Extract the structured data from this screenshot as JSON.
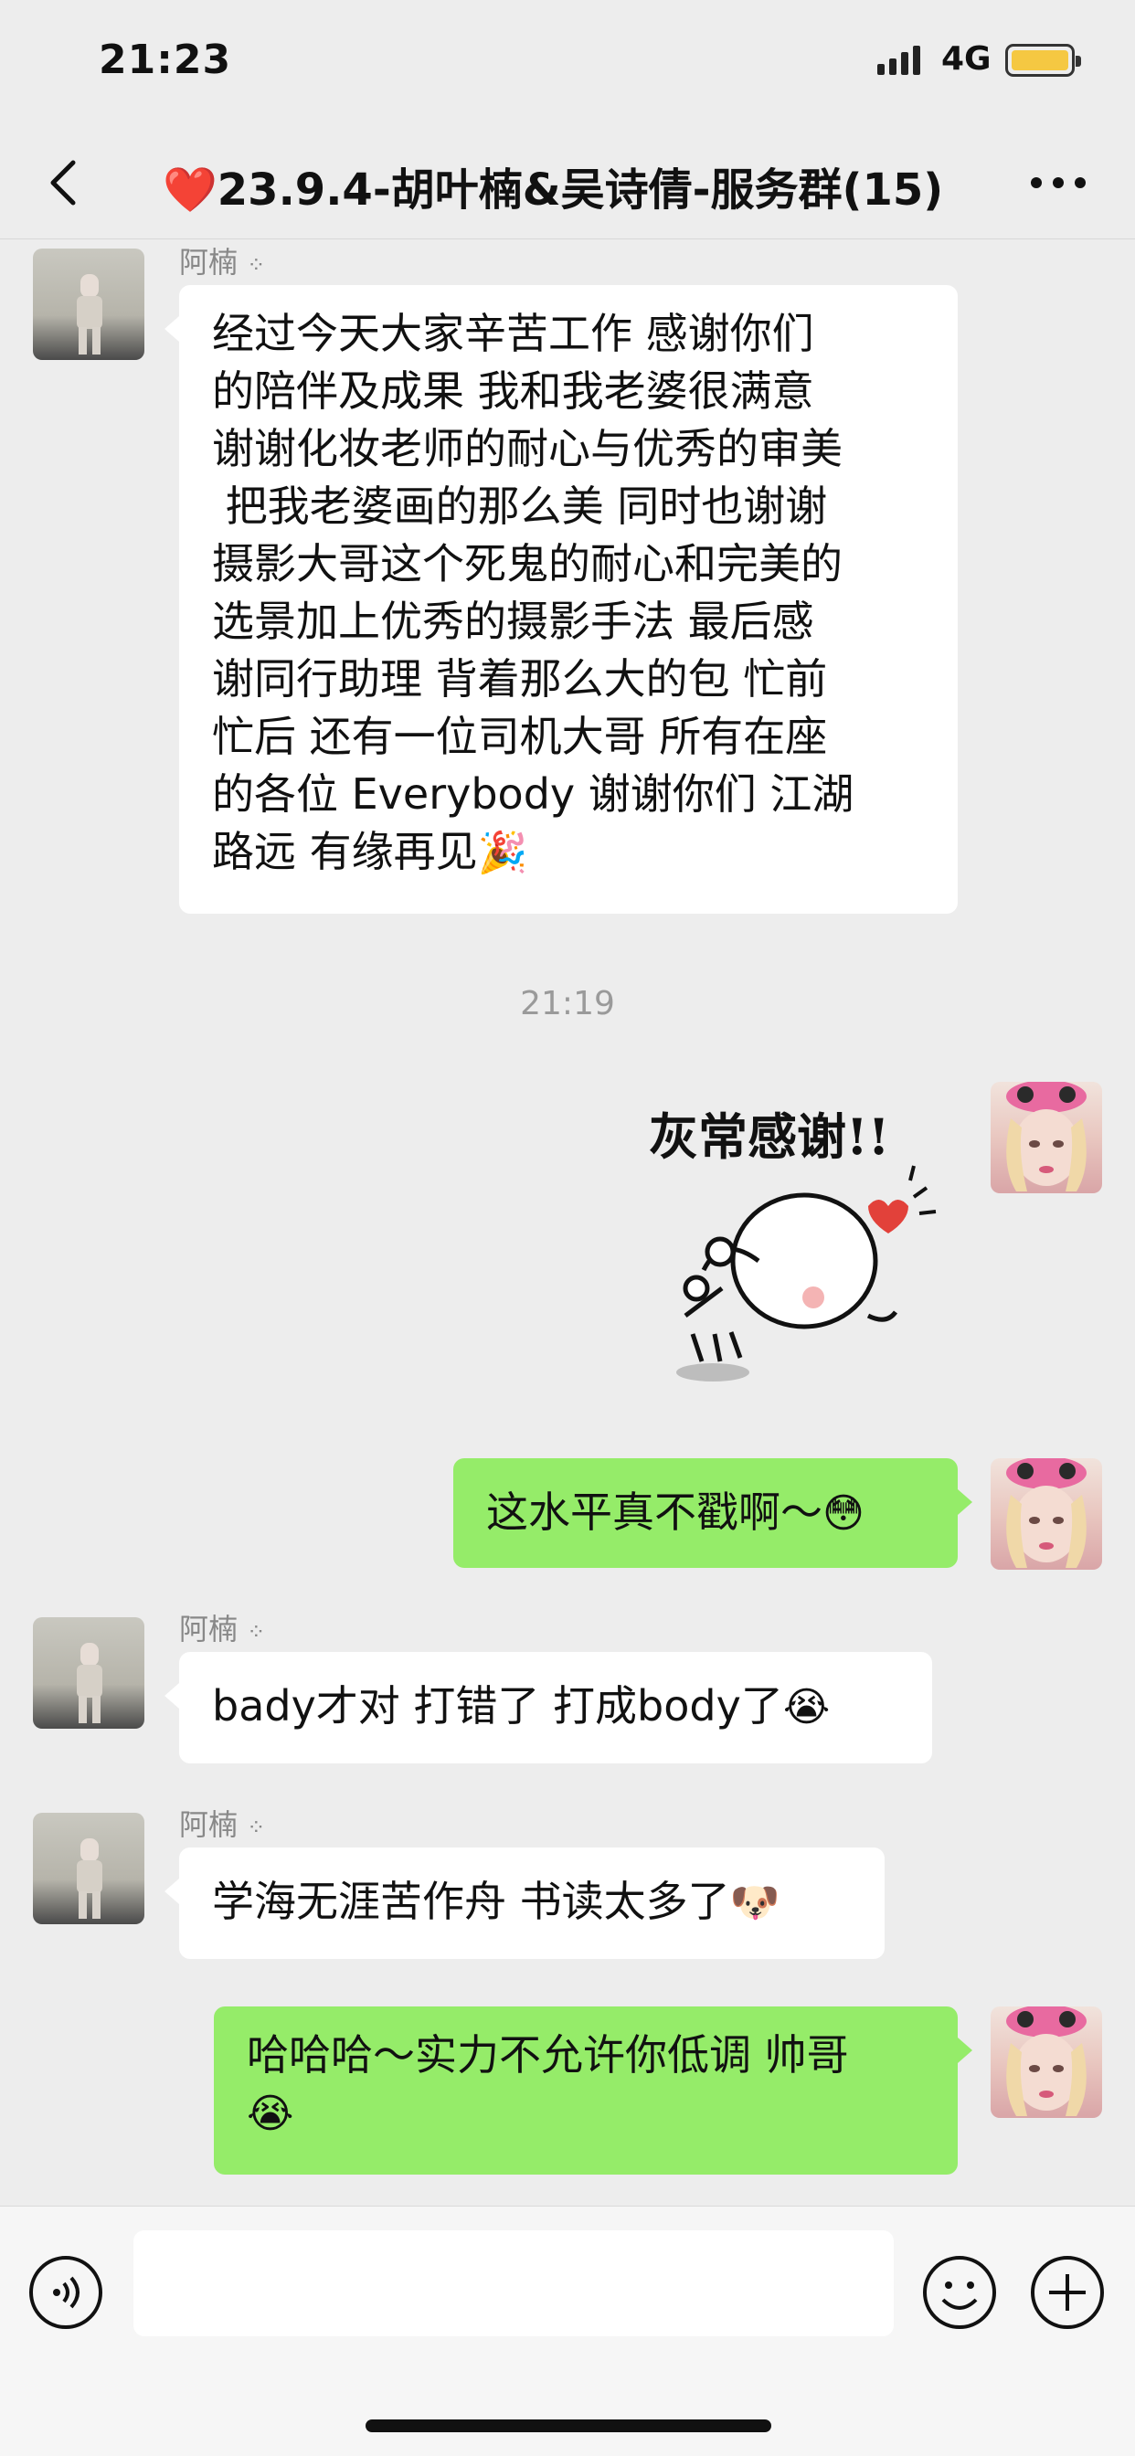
{
  "status_bar": {
    "time": "21:23",
    "network": "4G"
  },
  "nav": {
    "title": "❤️23.9.4-胡叶楠&吴诗倩-服务群(15)"
  },
  "messages": {
    "m1": {
      "sender": "阿楠",
      "lines": [
        "经过今天大家辛苦工作 感谢你们",
        "的陪伴及成果 我和我老婆很满意",
        "谢谢化妆老师的耐心与优秀的审美",
        " 把我老婆画的那么美 同时也谢谢",
        "摄影大哥这个死鬼的耐心和完美的",
        "选景加上优秀的摄影手法 最后感",
        "谢同行助理 背着那么大的包 忙前",
        "忙后 还有一位司机大哥 所有在座",
        "的各位 Everybody 谢谢你们 江湖",
        "路远 有缘再见"
      ],
      "emoji": "🎉"
    },
    "timestamp": "21:19",
    "sticker_text": "灰常感谢!!",
    "m2": {
      "text": "这水平真不戳啊～",
      "emoji": "😳"
    },
    "m3": {
      "sender": "阿楠",
      "text": "bady才对 打错了 打成body了",
      "emoji": "😭"
    },
    "m4": {
      "sender": "阿楠",
      "text": "学海无涯苦作舟 书读太多了",
      "emoji": "🐶"
    },
    "m5": {
      "line1": "哈哈哈～实力不允许你低调 帅哥",
      "emoji": "😭"
    }
  },
  "input": {
    "placeholder": ""
  },
  "colors": {
    "chat_bg": "#ededed",
    "self_bubble": "#95ec69",
    "other_bubble": "#ffffff"
  }
}
